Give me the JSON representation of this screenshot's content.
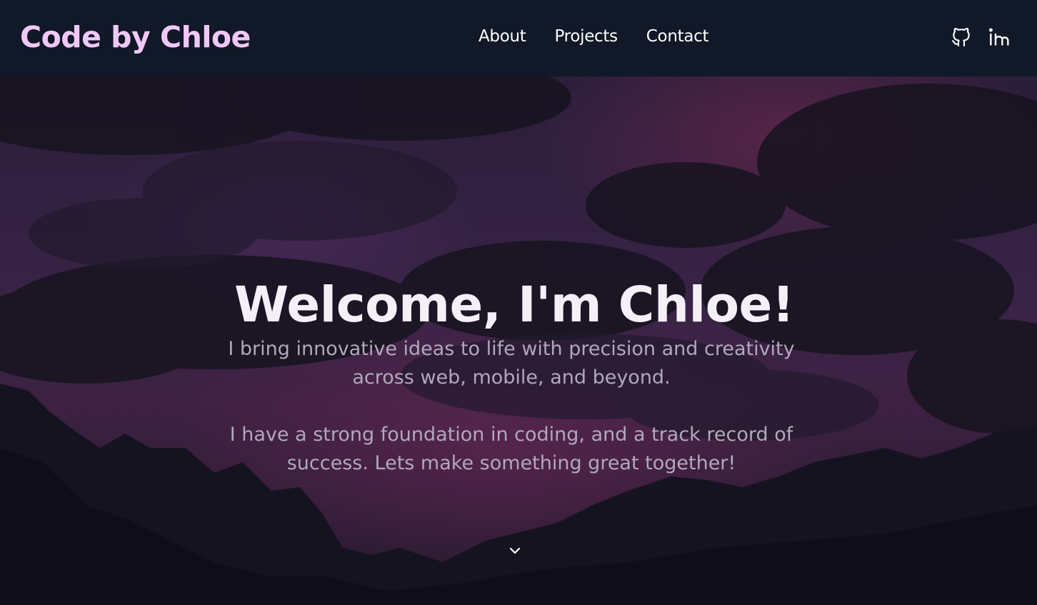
{
  "header": {
    "brand": "Code by Chloe",
    "nav": [
      {
        "label": "About"
      },
      {
        "label": "Projects"
      },
      {
        "label": "Contact"
      }
    ],
    "social": [
      {
        "icon": "github-icon"
      },
      {
        "icon": "linkedin-icon"
      }
    ]
  },
  "hero": {
    "title": "Welcome, I'm Chloe!",
    "paragraph_1": "I bring innovative ideas to life with precision and creativity across web, mobile, and beyond.",
    "paragraph_2": "I have a strong foundation in coding, and a track record of success. Lets make something great together!",
    "scroll_icon": "chevron-down-icon"
  },
  "colors": {
    "brand": "#f0c8f8",
    "navbar_bg": "#111827",
    "hero_title": "#f3f0f7",
    "hero_text": "#b0a8bb"
  }
}
